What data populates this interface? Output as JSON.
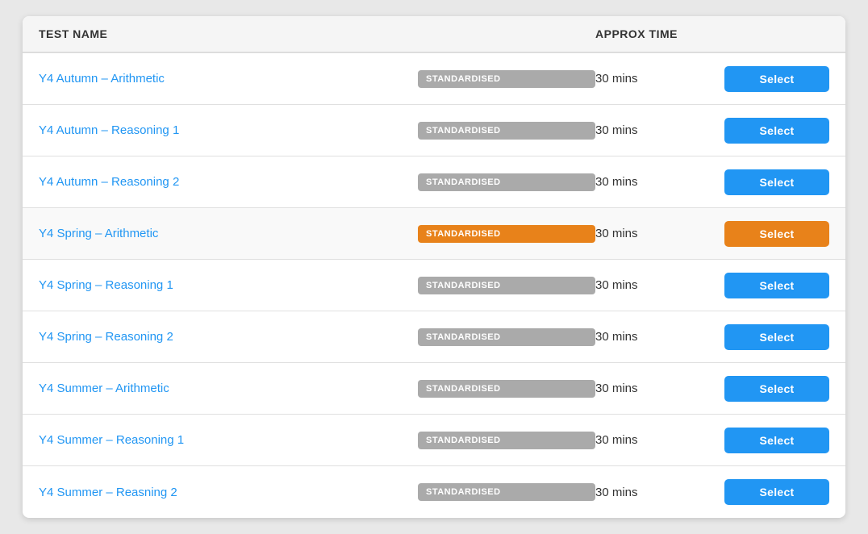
{
  "table": {
    "headers": {
      "test_name": "TEST NAME",
      "approx_time": "APPROX TIME"
    },
    "rows": [
      {
        "id": 1,
        "test_name": "Y4 Autumn – Arithmetic",
        "badge_label": "STANDARDISED",
        "badge_type": "grey",
        "time": "30 mins",
        "select_label": "Select",
        "select_type": "blue",
        "highlighted": false
      },
      {
        "id": 2,
        "test_name": "Y4 Autumn – Reasoning 1",
        "badge_label": "STANDARDISED",
        "badge_type": "grey",
        "time": "30 mins",
        "select_label": "Select",
        "select_type": "blue",
        "highlighted": false
      },
      {
        "id": 3,
        "test_name": "Y4 Autumn – Reasoning 2",
        "badge_label": "STANDARDISED",
        "badge_type": "grey",
        "time": "30 mins",
        "select_label": "Select",
        "select_type": "blue",
        "highlighted": false
      },
      {
        "id": 4,
        "test_name": "Y4 Spring – Arithmetic",
        "badge_label": "STANDARDISED",
        "badge_type": "orange",
        "time": "30 mins",
        "select_label": "Select",
        "select_type": "orange",
        "highlighted": true
      },
      {
        "id": 5,
        "test_name": "Y4 Spring – Reasoning 1",
        "badge_label": "STANDARDISED",
        "badge_type": "grey",
        "time": "30 mins",
        "select_label": "Select",
        "select_type": "blue",
        "highlighted": false
      },
      {
        "id": 6,
        "test_name": "Y4 Spring – Reasoning 2",
        "badge_label": "STANDARDISED",
        "badge_type": "grey",
        "time": "30 mins",
        "select_label": "Select",
        "select_type": "blue",
        "highlighted": false
      },
      {
        "id": 7,
        "test_name": "Y4 Summer – Arithmetic",
        "badge_label": "STANDARDISED",
        "badge_type": "grey",
        "time": "30 mins",
        "select_label": "Select",
        "select_type": "blue",
        "highlighted": false
      },
      {
        "id": 8,
        "test_name": "Y4 Summer – Reasoning 1",
        "badge_label": "STANDARDISED",
        "badge_type": "grey",
        "time": "30 mins",
        "select_label": "Select",
        "select_type": "blue",
        "highlighted": false
      },
      {
        "id": 9,
        "test_name": "Y4 Summer – Reasning 2",
        "badge_label": "STANDARDISED",
        "badge_type": "grey",
        "time": "30 mins",
        "select_label": "Select",
        "select_type": "blue",
        "highlighted": false
      }
    ]
  }
}
